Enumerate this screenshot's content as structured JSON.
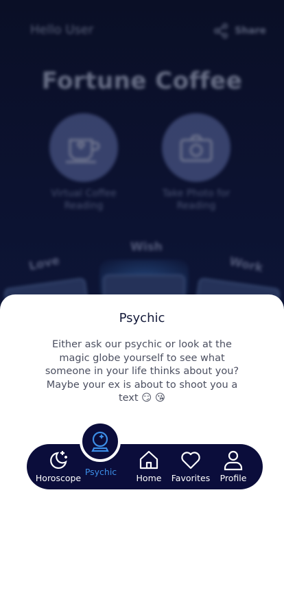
{
  "background": {
    "greeting": "Hello User",
    "share_label": "Share",
    "app_title": "Fortune Coffee",
    "actions": [
      {
        "label": "Virtual Coffee Reading",
        "icon": "coffee-cup-icon"
      },
      {
        "label": "Take Photo for Reading",
        "icon": "camera-icon"
      }
    ],
    "cards": {
      "wish": "Wish",
      "love": "Love",
      "work": "Work"
    }
  },
  "sheet": {
    "title": "Psychic",
    "description": "Either ask our psychic or look at the magic globe yourself to see what someone in your life thinks about you? Maybe your ex is about to shoot you a text 😏 😘"
  },
  "nav": {
    "items": [
      {
        "label": "Horoscope",
        "icon": "moon-stars-icon"
      },
      {
        "label": "Psychic",
        "icon": "crystal-ball-icon",
        "active": true
      },
      {
        "label": "Home",
        "icon": "home-icon"
      },
      {
        "label": "Favorites",
        "icon": "heart-icon"
      },
      {
        "label": "Profile",
        "icon": "user-icon"
      }
    ]
  },
  "colors": {
    "nav_bg": "#0b0d3b",
    "active": "#3c8ee8",
    "title": "#141a3a"
  }
}
